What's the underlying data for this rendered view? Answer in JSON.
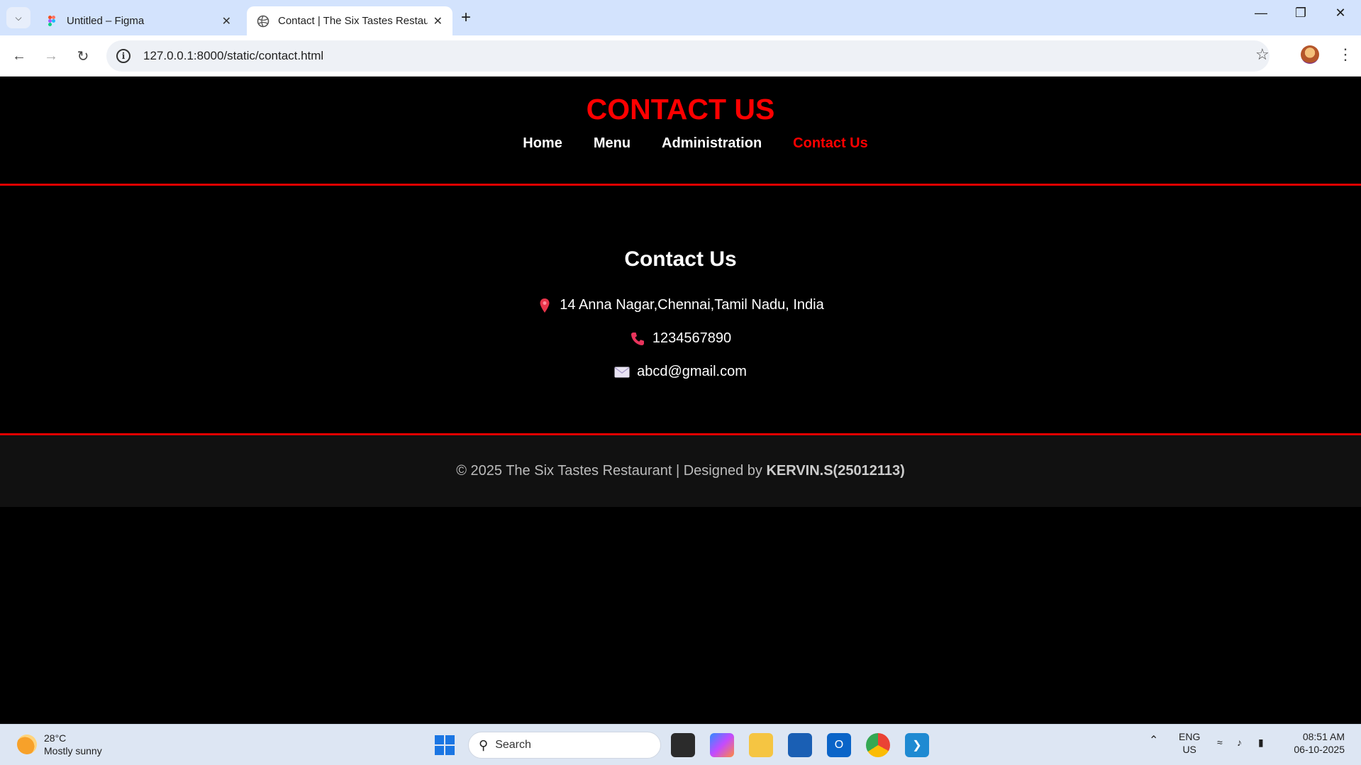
{
  "browser": {
    "tabs": [
      {
        "title": "Untitled – Figma",
        "active": false,
        "icon": "figma-icon"
      },
      {
        "title": "Contact | The Six Tastes Restaurant",
        "active": true,
        "icon": "globe-icon"
      }
    ],
    "url": "127.0.0.1:8000/static/contact.html"
  },
  "site": {
    "title": "CONTACT US",
    "nav": [
      {
        "label": "Home",
        "active": false
      },
      {
        "label": "Menu",
        "active": false
      },
      {
        "label": "Administration",
        "active": false
      },
      {
        "label": "Contact Us",
        "active": true
      }
    ],
    "contact": {
      "heading": "Contact Us",
      "address": "14 Anna Nagar,Chennai,Tamil Nadu, India",
      "phone": "1234567890",
      "email": "abcd@gmail.com"
    },
    "footer": {
      "text": "© 2025 The Six Tastes Restaurant | Designed by ",
      "designer": "KERVIN.S(25012113)"
    },
    "colors": {
      "accent": "#ff0000",
      "background": "#000000",
      "footer_bg": "#111111"
    }
  },
  "taskbar": {
    "weather": {
      "temp": "28°C",
      "condition": "Mostly sunny"
    },
    "search_placeholder": "Search",
    "language": {
      "line1": "ENG",
      "line2": "US"
    },
    "clock": {
      "time": "08:51 AM",
      "date": "06-10-2025"
    }
  }
}
